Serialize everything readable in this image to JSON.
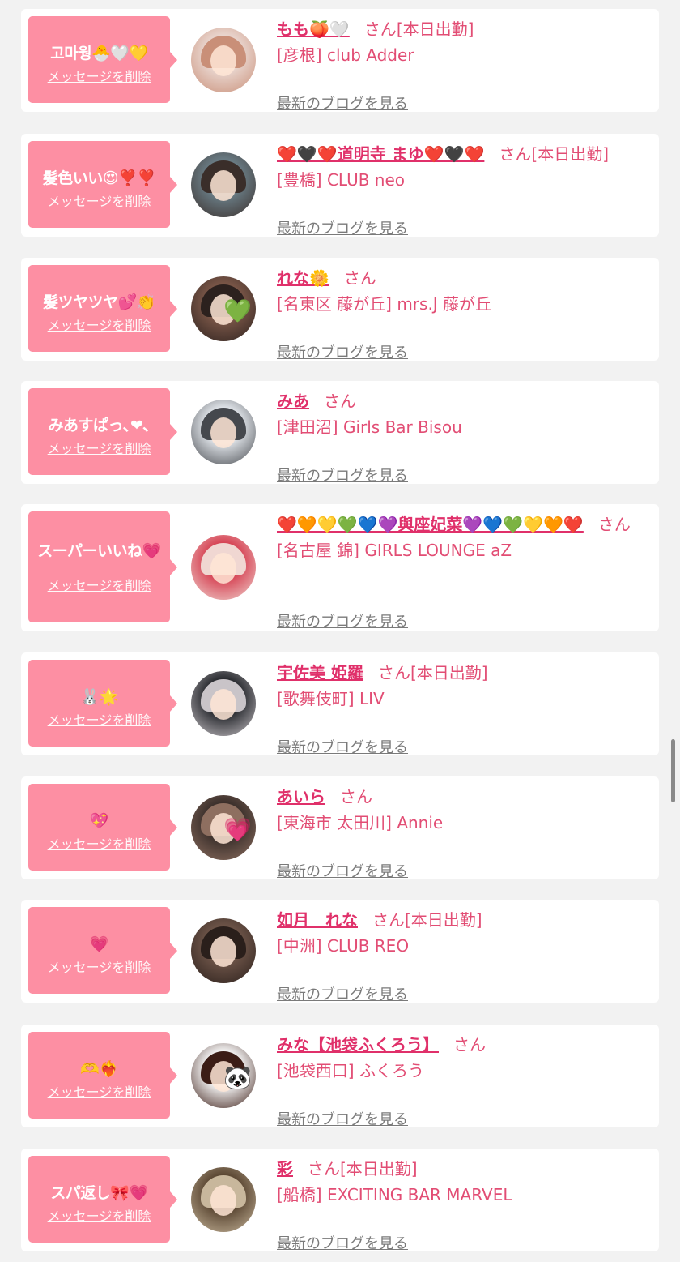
{
  "theme": {
    "bubble_color": "#fd8fa3",
    "name_color": "#e0306a",
    "text_color": "#e24d74",
    "link_gray": "#7a7a7a",
    "background": "#f2f2f2"
  },
  "labels": {
    "delete": "メッセージを削除",
    "blog": "最新のブログを見る",
    "san": "さん"
  },
  "items": [
    {
      "message": "고마웡🐣🤍💛",
      "name": "もも🍑🤍",
      "today": "[本日出勤]",
      "shop": "[彦根] club Adder",
      "avatar_colors": [
        "#e9d6cf",
        "#c98f78"
      ]
    },
    {
      "message": "髪色いい😍❣️❣️",
      "name": "❤️🖤❤️道明寺 まゆ❤️🖤❤️",
      "today": "[本日出勤]",
      "shop": "[豊橋] CLUB neo",
      "avatar_colors": [
        "#6a7d86",
        "#3a2e2a"
      ]
    },
    {
      "message": "髪ツヤツヤ💕👏",
      "name": "れな🌼",
      "today": "",
      "shop": "[名東区 藤が丘] mrs.J 藤が丘",
      "avatar_colors": [
        "#7b5748",
        "#2c211e"
      ],
      "avatar_heart": "💚"
    },
    {
      "message": "みあすぱっ､❤︎､",
      "name": "みあ",
      "today": "",
      "shop": "[津田沼] Girls Bar Bisou",
      "avatar_colors": [
        "#dfe3e8",
        "#45484d"
      ]
    },
    {
      "message": "スーパーいいね💗",
      "name": "❤️🧡💛💚💙💜與座妃菜💜💙💚💛🧡❤️",
      "today": "",
      "shop": "[名古屋 錦] GIRLS LOUNGE aZ",
      "avatar_colors": [
        "#d64354",
        "#f0d7d2"
      ],
      "tall": true
    },
    {
      "message": "🐰🌟",
      "name": "宇佐美 姫羅",
      "today": "[本日出勤]",
      "shop": "[歌舞伎町] LIV",
      "avatar_colors": [
        "#27292e",
        "#c9c4c8"
      ]
    },
    {
      "message": "💖",
      "name": "あいら",
      "today": "",
      "shop": "[東海市 太田川] Annie",
      "avatar_colors": [
        "#3a2f2b",
        "#8e6f60"
      ],
      "avatar_heart": "💗"
    },
    {
      "message": "💗",
      "name": "如月　れな",
      "today": "[本日出勤]",
      "shop": "[中洲] CLUB REO",
      "avatar_colors": [
        "#6d5448",
        "#2a1f1b"
      ]
    },
    {
      "message": "🫶❤️‍🔥",
      "name": "みな【池袋ふくろう】",
      "today": "",
      "shop": "[池袋西口] ふくろう",
      "avatar_colors": [
        "#f5f5f5",
        "#3b1d16"
      ],
      "avatar_heart": "🐼"
    },
    {
      "message": "スパ返し🎀💗",
      "name": "彩",
      "today": "[本日出勤]",
      "shop": "[船橋] EXCITING BAR MARVEL",
      "avatar_colors": [
        "#5a4632",
        "#c8b79c"
      ]
    }
  ]
}
